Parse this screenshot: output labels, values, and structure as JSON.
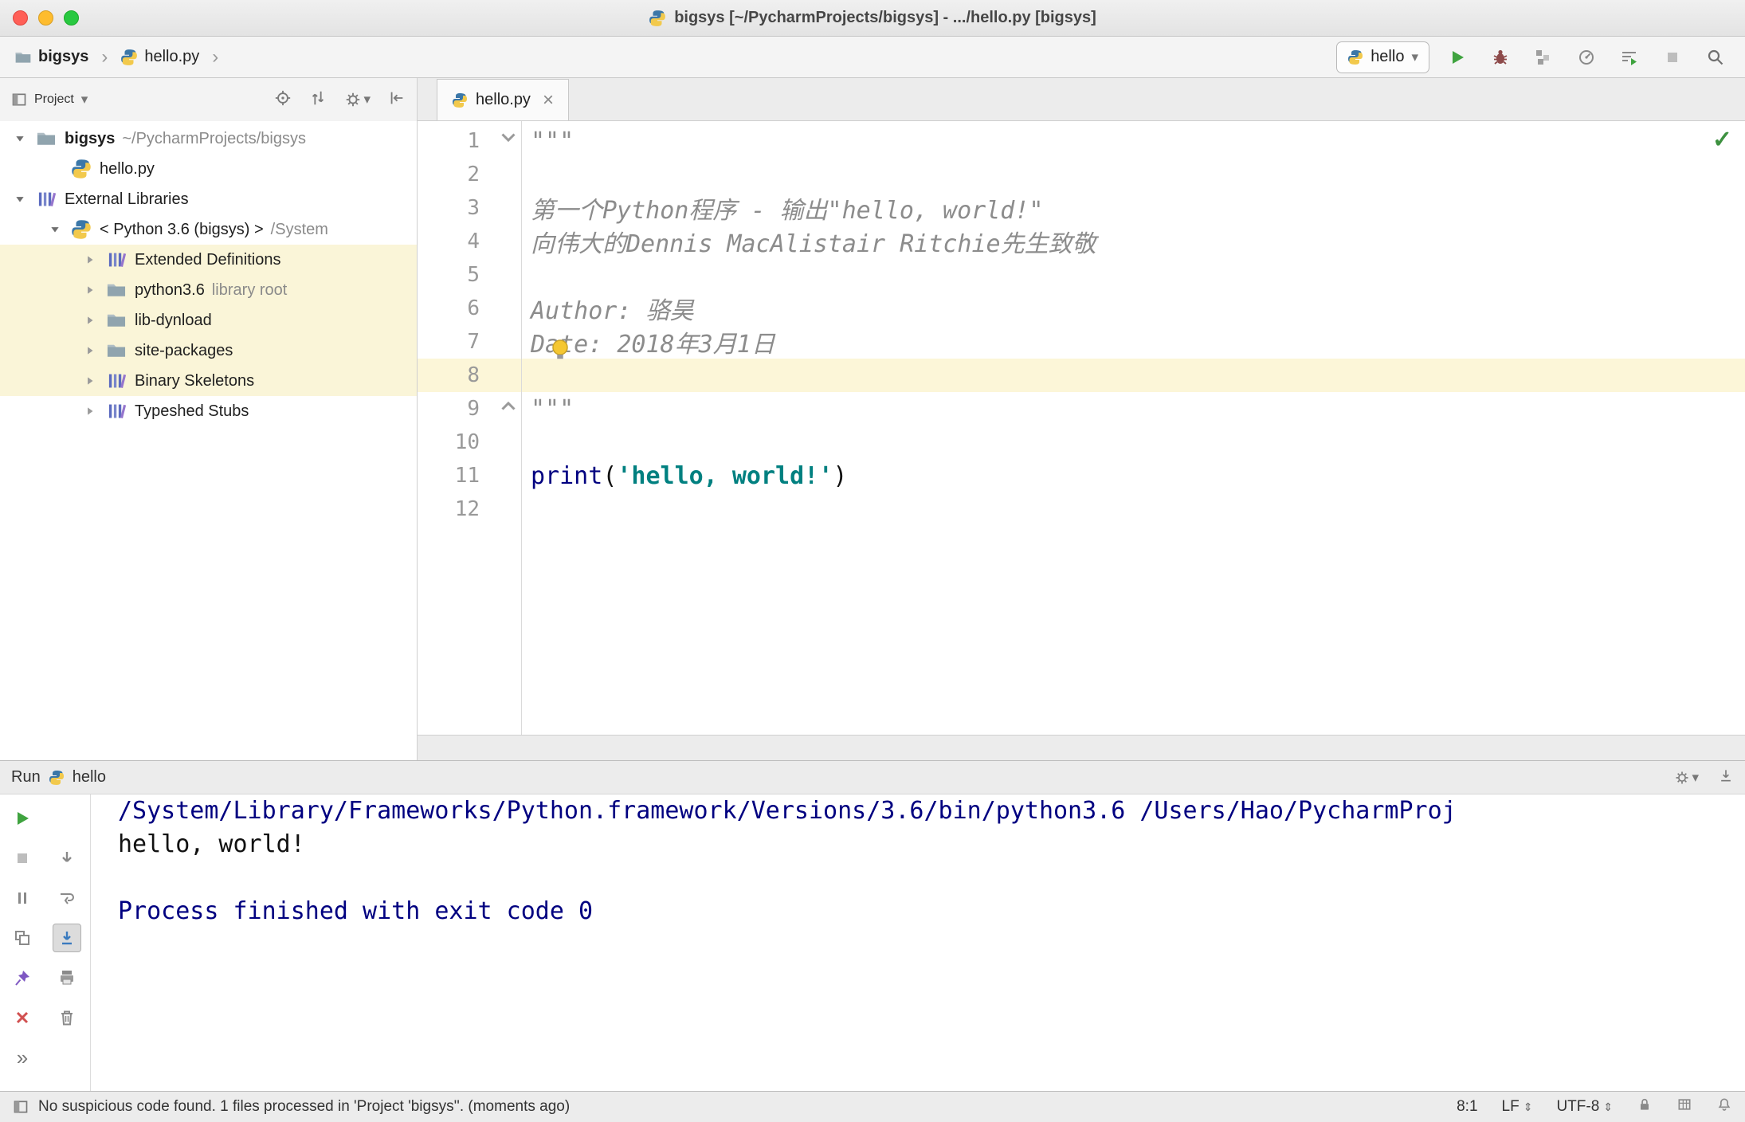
{
  "titlebar": {
    "title": "bigsys [~/PycharmProjects/bigsys] - .../hello.py [bigsys]"
  },
  "toolbar": {
    "breadcrumbs": [
      {
        "label": "bigsys"
      },
      {
        "label": "hello.py"
      }
    ],
    "run_config": "hello"
  },
  "project_panel": {
    "title": "Project",
    "tree": [
      {
        "label": "bigsys",
        "suffix": " ~/PycharmProjects/bigsys",
        "icon": "folder",
        "chevron": "down",
        "indent": 0,
        "bold": true,
        "highlight": false
      },
      {
        "label": "hello.py",
        "suffix": "",
        "icon": "python-file",
        "chevron": "none",
        "indent": 1,
        "bold": false,
        "highlight": false
      },
      {
        "label": "External Libraries",
        "suffix": "",
        "icon": "library",
        "chevron": "down",
        "indent": 0,
        "bold": false,
        "highlight": false
      },
      {
        "label": "< Python 3.6 (bigsys) >",
        "suffix": " /System",
        "icon": "python",
        "chevron": "down",
        "indent": 1,
        "bold": false,
        "highlight": false
      },
      {
        "label": "Extended Definitions",
        "suffix": "",
        "icon": "library",
        "chevron": "right",
        "indent": 2,
        "bold": false,
        "highlight": true
      },
      {
        "label": "python3.6",
        "suffix": " library root",
        "icon": "folder",
        "chevron": "right",
        "indent": 2,
        "bold": false,
        "highlight": true
      },
      {
        "label": "lib-dynload",
        "suffix": "",
        "icon": "folder",
        "chevron": "right",
        "indent": 2,
        "bold": false,
        "highlight": true
      },
      {
        "label": "site-packages",
        "suffix": "",
        "icon": "folder",
        "chevron": "right",
        "indent": 2,
        "bold": false,
        "highlight": true
      },
      {
        "label": "Binary Skeletons",
        "suffix": "",
        "icon": "library",
        "chevron": "right",
        "indent": 2,
        "bold": false,
        "highlight": true
      },
      {
        "label": "Typeshed Stubs",
        "suffix": "",
        "icon": "library",
        "chevron": "right",
        "indent": 2,
        "bold": false,
        "highlight": false
      }
    ]
  },
  "editor": {
    "tab": "hello.py",
    "lines": [
      {
        "n": 1,
        "current": false,
        "segments": [
          {
            "t": "\"\"\"",
            "c": "doc"
          }
        ]
      },
      {
        "n": 2,
        "current": false,
        "segments": []
      },
      {
        "n": 3,
        "current": false,
        "segments": [
          {
            "t": "第一个Python程序 - 输出\"hello, world!\"",
            "c": "doc"
          }
        ]
      },
      {
        "n": 4,
        "current": false,
        "segments": [
          {
            "t": "向伟大的Dennis MacAlistair Ritchie先生致敬",
            "c": "doc"
          }
        ]
      },
      {
        "n": 5,
        "current": false,
        "segments": []
      },
      {
        "n": 6,
        "current": false,
        "segments": [
          {
            "t": "Author: 骆昊",
            "c": "doc"
          }
        ]
      },
      {
        "n": 7,
        "current": false,
        "segments": [
          {
            "t": "Date: 2018年3月1日",
            "c": "doc"
          }
        ]
      },
      {
        "n": 8,
        "current": true,
        "segments": []
      },
      {
        "n": 9,
        "current": false,
        "segments": [
          {
            "t": "\"\"\"",
            "c": "doc"
          }
        ]
      },
      {
        "n": 10,
        "current": false,
        "segments": []
      },
      {
        "n": 11,
        "current": false,
        "segments": [
          {
            "t": "print",
            "c": "kw"
          },
          {
            "t": "(",
            "c": "plain"
          },
          {
            "t": "'hello, world!'",
            "c": "str"
          },
          {
            "t": ")",
            "c": "plain"
          }
        ]
      },
      {
        "n": 12,
        "current": false,
        "segments": []
      }
    ]
  },
  "run_panel": {
    "title": "Run",
    "config": "hello",
    "console": [
      {
        "t": "/System/Library/Frameworks/Python.framework/Versions/3.6/bin/python3.6 /Users/Hao/PycharmProj",
        "c": "info"
      },
      {
        "t": "hello, world!",
        "c": "plain"
      },
      {
        "t": "",
        "c": "plain"
      },
      {
        "t": "Process finished with exit code 0",
        "c": "info"
      }
    ]
  },
  "statusbar": {
    "message": "No suspicious code found. 1 files processed in 'Project 'bigsys''. (moments ago)",
    "caret_position": "8:1",
    "line_separator": "LF",
    "encoding": "UTF-8"
  },
  "glyphs": {
    "chevron_down": "▾",
    "breadcrumb_sep": "›",
    "close": "×",
    "more": "»",
    "check": "✓",
    "updown": "⇕"
  },
  "colors": {
    "run_green": "#3fa33f",
    "tree_highlight": "#faf5d8",
    "current_line": "#fcf6d8",
    "keyword": "#000080",
    "string": "#008080",
    "docstring": "#8c8c8c",
    "console_info": "#000080",
    "error_red": "#d15050"
  }
}
